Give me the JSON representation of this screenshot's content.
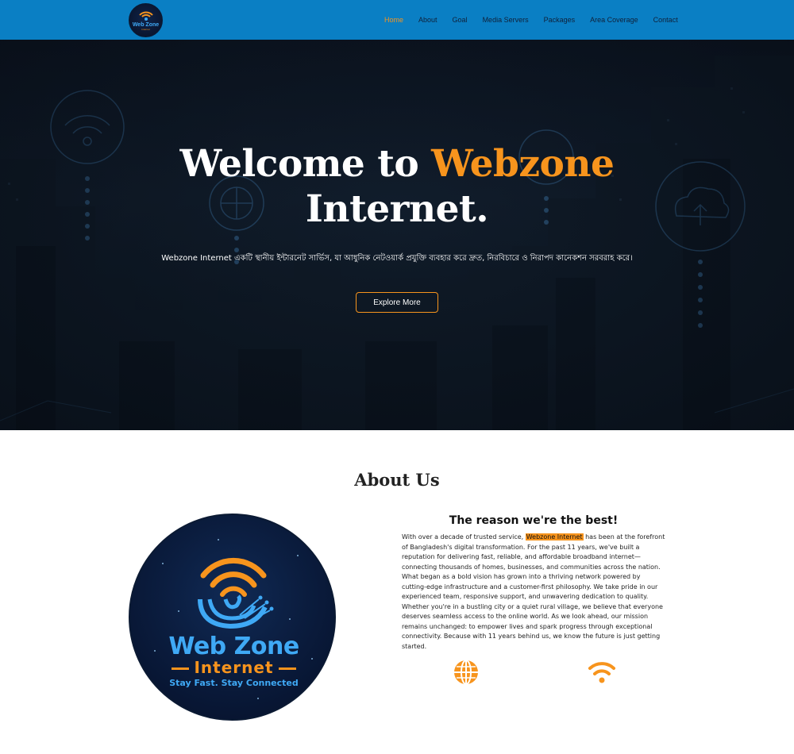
{
  "nav": {
    "logo_text": "Web Zone",
    "logo_sub": "Internet",
    "links": [
      "Home",
      "About",
      "Goal",
      "Media Servers",
      "Packages",
      "Area Coverage",
      "Contact"
    ],
    "active": "Home"
  },
  "hero": {
    "title_prefix": "Welcome to ",
    "title_accent": "Webzone",
    "title_suffix": "Internet.",
    "subtitle": "Webzone Internet একটি স্থানীয় ইন্টারনেট সার্ভিস, যা আধুনিক নেটওয়ার্ক প্রযুক্তি ব্যবহার করে দ্রুত, নিরবিচারে ও নিরাপদ কানেকশন সরবরাহ করে।",
    "button": "Explore More"
  },
  "about": {
    "heading": "About Us",
    "logo_line1": "Web Zone",
    "logo_line2": "Internet",
    "logo_tagline": "Stay Fast. Stay Connected",
    "reason_title": "The reason we're the best!",
    "text_before": "With over a decade of trusted service, ",
    "text_highlight": "Webzone Internet",
    "text_after": " has been at the forefront of Bangladesh's digital transformation. For the past 11 years, we've built a reputation for delivering fast, reliable, and affordable broadband internet—connecting thousands of homes, businesses, and communities across the nation. What began as a bold vision has grown into a thriving network powered by cutting-edge infrastructure and a customer-first philosophy. We take pride in our experienced team, responsive support, and unwavering dedication to quality. Whether you're in a bustling city or a quiet rural village, we believe that everyone deserves seamless access to the online world. As we look ahead, our mission remains unchanged: to empower lives and spark progress through exceptional connectivity. Because with 11 years behind us, we know the future is just getting started.",
    "icons": [
      "globe-icon",
      "wifi-icon"
    ]
  },
  "colors": {
    "nav_bg": "#0a7fc4",
    "accent": "#f7941d",
    "logo_blue": "#3fa9f5"
  }
}
